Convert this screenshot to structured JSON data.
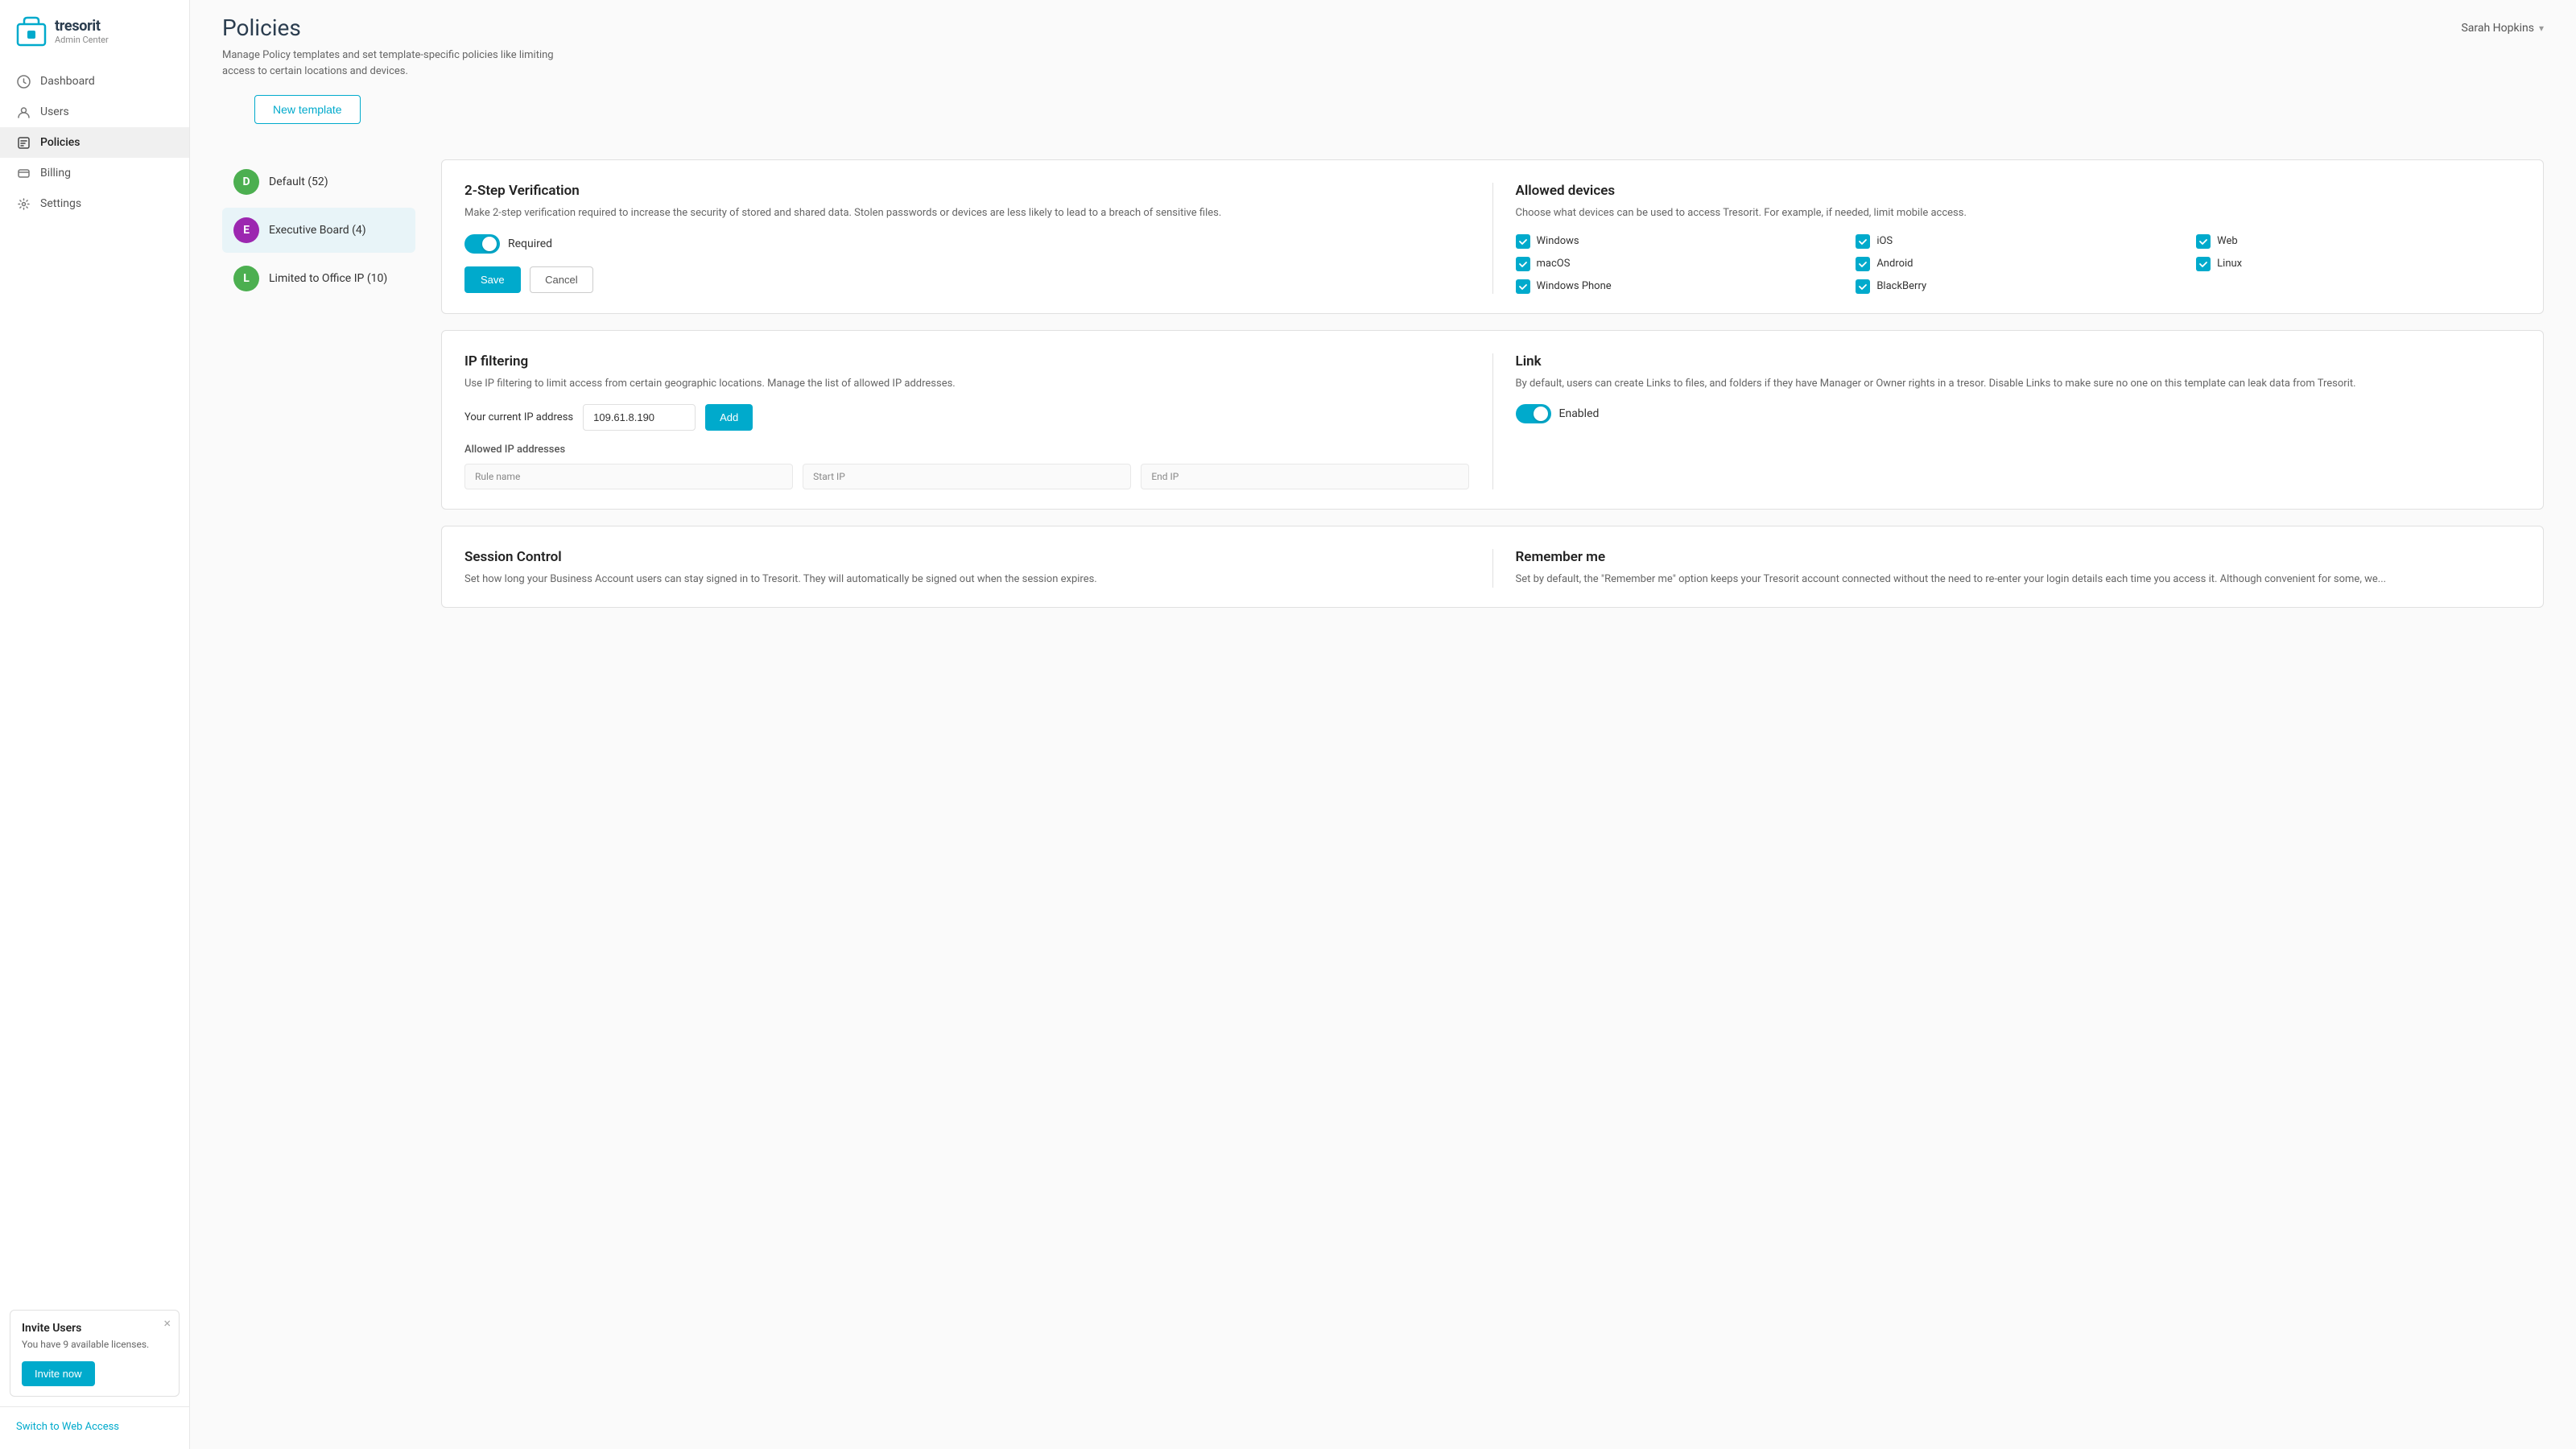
{
  "logo": {
    "brand": "tresorit",
    "sub": "Admin Center"
  },
  "nav": {
    "items": [
      {
        "id": "dashboard",
        "label": "Dashboard",
        "icon": "dashboard-icon",
        "active": false
      },
      {
        "id": "users",
        "label": "Users",
        "icon": "users-icon",
        "active": false
      },
      {
        "id": "policies",
        "label": "Policies",
        "icon": "policies-icon",
        "active": true
      },
      {
        "id": "billing",
        "label": "Billing",
        "icon": "billing-icon",
        "active": false
      },
      {
        "id": "settings",
        "label": "Settings",
        "icon": "settings-icon",
        "active": false
      }
    ],
    "switch_web": "Switch to Web Access"
  },
  "invite_banner": {
    "title": "Invite Users",
    "desc": "You have 9 available licenses.",
    "button": "Invite now"
  },
  "header": {
    "title": "Policies",
    "user": "Sarah Hopkins",
    "desc_line1": "Manage Policy templates and set template-specific policies like limiting",
    "desc_line2": "access to certain locations and devices.",
    "new_template_btn": "New template"
  },
  "policies": [
    {
      "id": "default",
      "initial": "D",
      "name": "Default (52)",
      "badge_class": "badge-default",
      "selected": false
    },
    {
      "id": "exec",
      "initial": "E",
      "name": "Executive Board (4)",
      "badge_class": "badge-exec",
      "selected": true
    },
    {
      "id": "limited",
      "initial": "L",
      "name": "Limited to Office IP (10)",
      "badge_class": "badge-limited",
      "selected": false
    }
  ],
  "two_step": {
    "title": "2-Step Verification",
    "desc": "Make 2-step verification required to increase the security of stored and shared data. Stolen passwords or devices are less likely to lead to a breach of sensitive files.",
    "toggle_label": "Required",
    "toggle_on": true,
    "save_btn": "Save",
    "cancel_btn": "Cancel"
  },
  "allowed_devices": {
    "title": "Allowed devices",
    "desc": "Choose what devices can be used to access Tresorit. For example, if needed, limit mobile access.",
    "devices": [
      {
        "label": "Windows",
        "checked": true
      },
      {
        "label": "iOS",
        "checked": true
      },
      {
        "label": "Web",
        "checked": true
      },
      {
        "label": "macOS",
        "checked": true
      },
      {
        "label": "Android",
        "checked": true
      },
      {
        "label": "Linux",
        "checked": true
      },
      {
        "label": "Windows Phone",
        "checked": true
      },
      {
        "label": "BlackBerry",
        "checked": true
      }
    ]
  },
  "ip_filtering": {
    "title": "IP filtering",
    "desc": "Use IP filtering to limit access from certain geographic locations. Manage the list of allowed IP addresses.",
    "current_ip_label": "Your current IP address",
    "current_ip": "109.61.8.190",
    "add_btn": "Add",
    "allowed_title": "Allowed IP addresses",
    "table_headers": [
      "Rule name",
      "Start IP",
      "End IP"
    ]
  },
  "link": {
    "title": "Link",
    "desc": "By default, users can create Links to files, and folders if they have Manager or Owner rights in a tresor. Disable Links to make sure no one on this template can leak data from Tresorit.",
    "toggle_label": "Enabled",
    "toggle_on": true
  },
  "session_control": {
    "title": "Session Control",
    "desc": "Set how long your Business Account users can stay signed in to Tresorit. They will automatically be signed out when the session expires."
  },
  "remember_me": {
    "title": "Remember me",
    "desc": "Set by default, the \"Remember me\" option keeps your Tresorit account connected without the need to re-enter your login details each time you access it. Although convenient for some, we..."
  }
}
